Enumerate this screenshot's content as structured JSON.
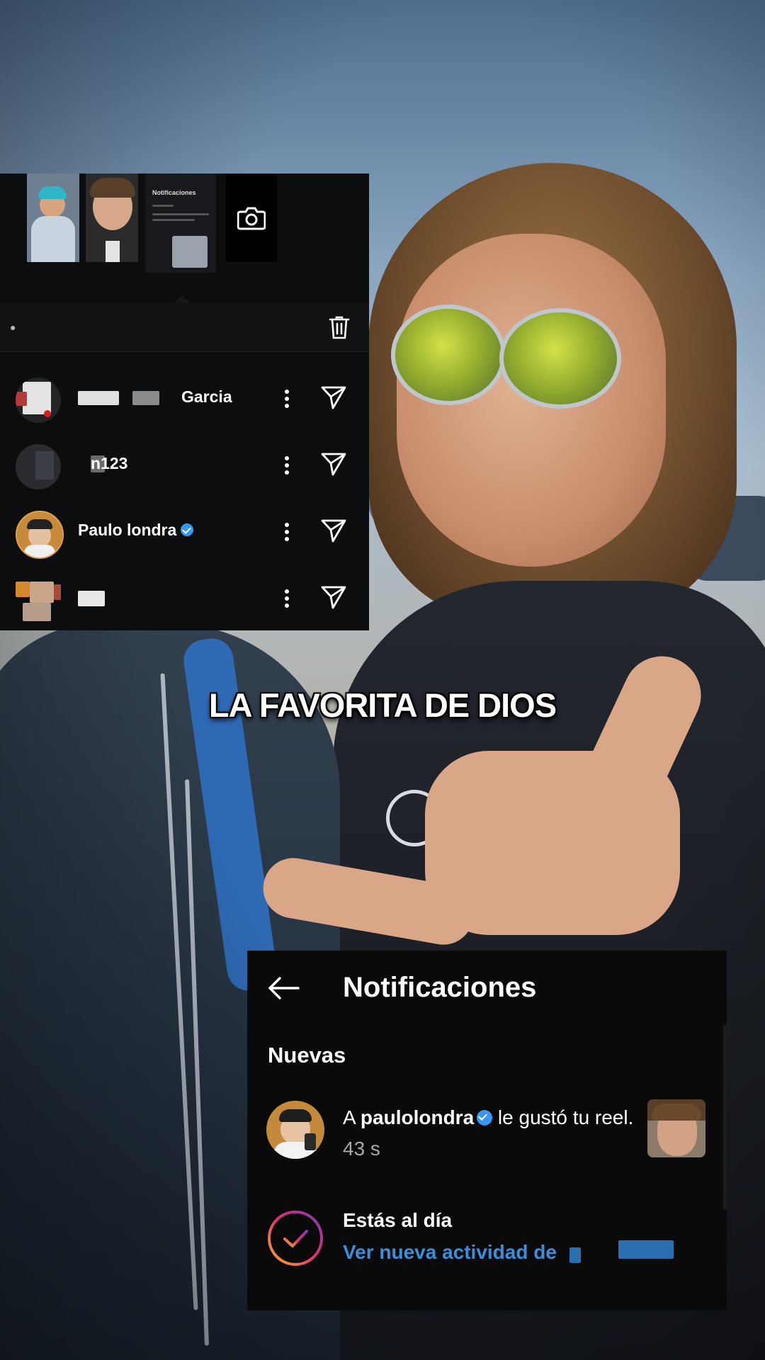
{
  "caption": "LA FAVORITA DE DIOS",
  "share_sheet": {
    "thumbnail_note": {
      "title": "Notificaciones"
    },
    "contacts": [
      {
        "name": "Garcia",
        "verified": false
      },
      {
        "name": "n123",
        "verified": false
      },
      {
        "name": "Paulo londra",
        "verified": true
      },
      {
        "name": "",
        "verified": false
      }
    ]
  },
  "notifications": {
    "title": "Notificaciones",
    "section": "Nuevas",
    "item": {
      "prefix": "A ",
      "user": "paulolondra",
      "action": " le gustó tu reel.",
      "time": " 43 s",
      "verified": true
    },
    "up_to_date": {
      "title": "Estás al día",
      "link": "Ver nueva actividad de"
    }
  },
  "colors": {
    "panel_bg": "#0c0d0f",
    "verified_blue": "#3897f0",
    "link_blue": "#3a8fd8",
    "ring_gradient": [
      "#f7b032",
      "#e1306c",
      "#833ab4"
    ]
  },
  "icons": {
    "camera": "camera-icon",
    "trash": "trash-icon",
    "more": "more-vertical-icon",
    "send": "send-icon",
    "back": "back-arrow-icon",
    "check": "check-circle-icon"
  }
}
